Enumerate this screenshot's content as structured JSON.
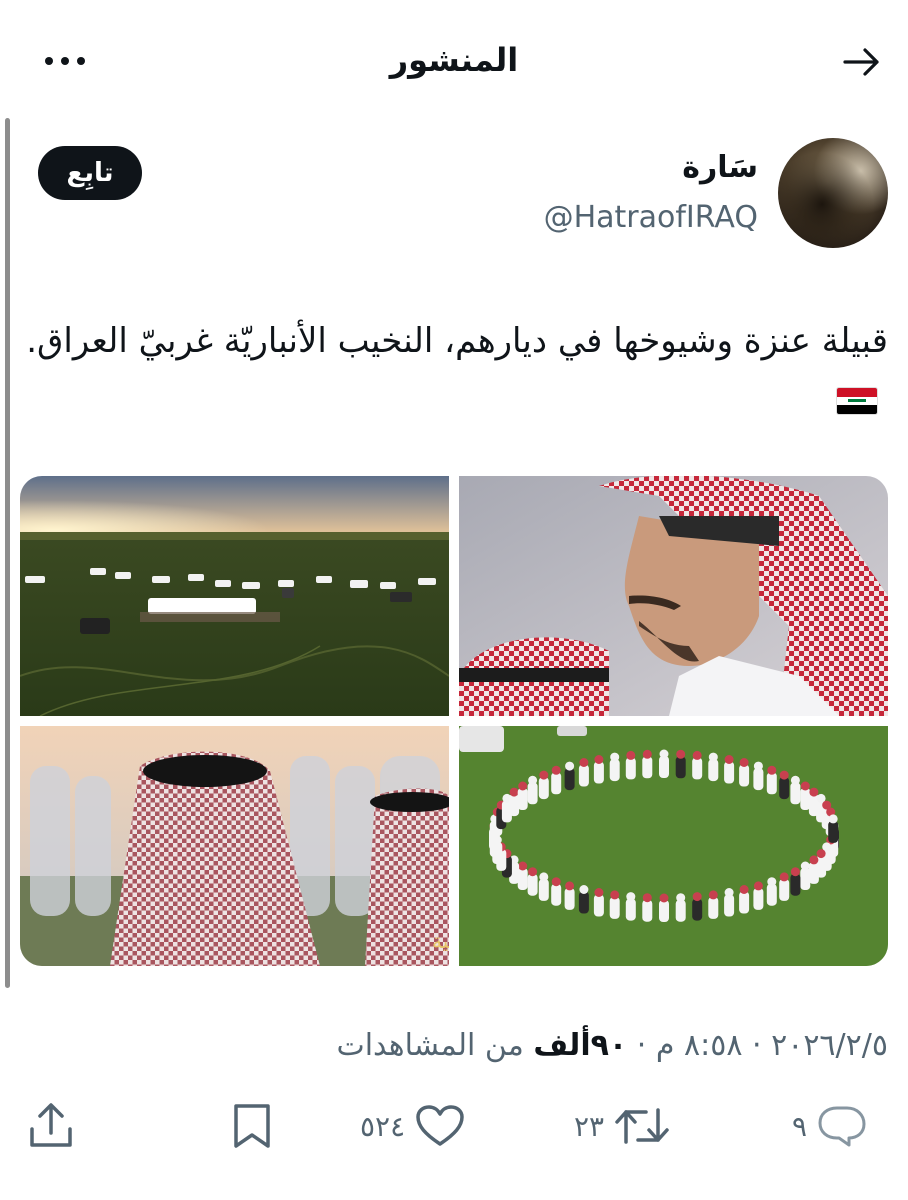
{
  "header": {
    "title": "المنشور",
    "back_icon": "arrow-right-icon",
    "more_icon": "more-dots-icon"
  },
  "author": {
    "display_name": "سَارة",
    "handle": "@HatraofIRAQ",
    "follow_label": "تابِع"
  },
  "post": {
    "text": "قبيلة عنزة وشيوخها في ديارهم، النخيب الأنباريّة غربيّ العراق.",
    "flag_icon": "iraq-flag-icon"
  },
  "media": {
    "count": 4,
    "watermark": "الرعية"
  },
  "meta": {
    "date": "٢٠٢٦/٢/٥",
    "separator": "·",
    "time": "٨:٥٨ م",
    "views": "٩٠ألف",
    "views_label": "من المشاهدات"
  },
  "actions": {
    "reply_count": "٩",
    "retweet_count": "٢٣",
    "like_count": "٥٢٤"
  },
  "colors": {
    "text_primary": "#0f1419",
    "text_secondary": "#536471",
    "button_bg": "#0f1419"
  }
}
